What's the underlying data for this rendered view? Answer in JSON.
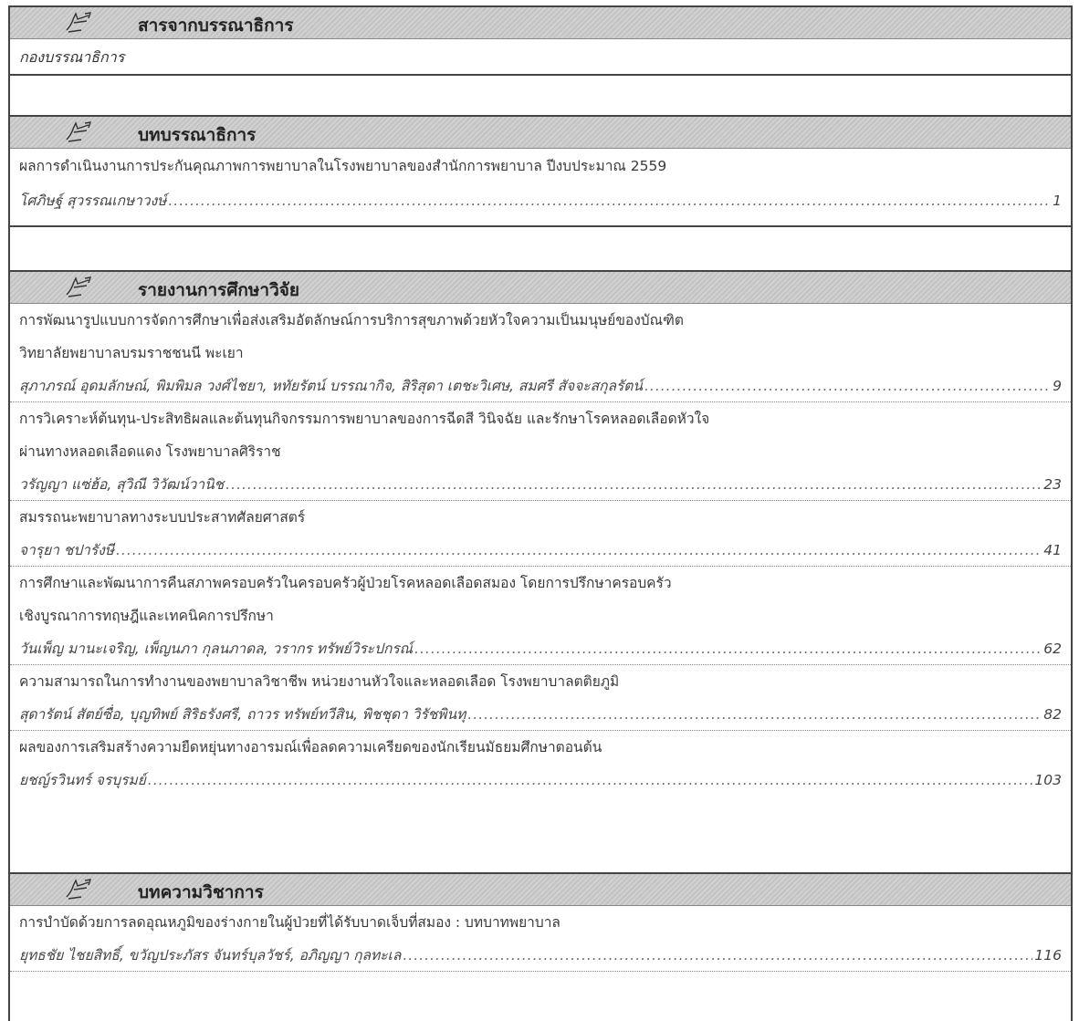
{
  "sections": [
    {
      "title": "สารจากบรรณาธิการ",
      "text": "กองบรรณาธิการ"
    },
    {
      "title": "บทบรรณาธิการ",
      "articles": [
        {
          "title_lines": [
            "ผลการดำเนินงานการประกันคุณภาพการพยาบาลในโรงพยาบาลของสำนักการพยาบาล ปีงบประมาณ 2559"
          ],
          "authors": "โศภิษฐ์ สุวรรณเกษาวงษ์",
          "page": "1"
        }
      ]
    },
    {
      "title": "รายงานการศึกษาวิจัย",
      "articles": [
        {
          "title_lines": [
            "การพัฒนารูปแบบการจัดการศึกษาเพื่อส่งเสริมอัตลักษณ์การบริการสุขภาพด้วยหัวใจความเป็นมนุษย์ของบัณฑิต",
            "วิทยาลัยพยาบาลบรมราชชนนี พะเยา"
          ],
          "authors": "สุภาภรณ์ อุดมลักษณ์, พิมพิมล วงศ์ไชยา, หทัยรัตน์ บรรณากิจ, สิริสุดา เตชะวิเศษ, สมศรี สัจจะสกุลรัตน์",
          "page": "9"
        },
        {
          "title_lines": [
            "การวิเคราะห์ต้นทุน-ประสิทธิผลและต้นทุนกิจกรรมการพยาบาลของการฉีดสี วินิจฉัย และรักษาโรคหลอดเลือดหัวใจ",
            "ผ่านทางหลอดเลือดแดง โรงพยาบาลศิริราช"
          ],
          "authors": "วรัญญา แซ่ฮ้อ, สุวิณี วิวัฒน์วานิช",
          "page": "23"
        },
        {
          "title_lines": [
            "สมรรถนะพยาบาลทางระบบประสาทศัลยศาสตร์"
          ],
          "authors": "จารุยา ชปารังษี",
          "page": "41"
        },
        {
          "title_lines": [
            "การศึกษาและพัฒนาการคืนสภาพครอบครัวในครอบครัวผู้ป่วยโรคหลอดเลือดสมอง โดยการปรึกษาครอบครัว",
            "เชิงบูรณาการทฤษฎีและเทคนิคการปรึกษา"
          ],
          "authors": "วันเพ็ญ มานะเจริญ, เพ็ญนภา กุลนภาดล, วรากร ทรัพย์วิระปกรณ์",
          "page": "62"
        },
        {
          "title_lines": [
            "ความสามารถในการทำงานของพยาบาลวิชาชีพ หน่วยงานหัวใจและหลอดเลือด โรงพยาบาลตติยภูมิ"
          ],
          "authors": "สุดารัตน์ สัตย์ซื่อ, บุญทิพย์ สิริธรังศรี, ถาวร ทรัพย์ทวีสิน, พิชชุดา วิรัชพินทุ",
          "page": "82"
        },
        {
          "title_lines": [
            "ผลของการเสริมสร้างความยืดหยุ่นทางอารมณ์เพื่อลดความเครียดของนักเรียนมัธยมศึกษาตอนต้น"
          ],
          "authors": "ยชญ์รวินทร์ จรบุรมย์",
          "page": "103"
        }
      ]
    },
    {
      "title": "บทความวิชาการ",
      "articles": [
        {
          "title_lines": [
            "การบำบัดด้วยการลดอุณหภูมิของร่างกายในผู้ป่วยที่ได้รับบาดเจ็บที่สมอง : บทบาทพยาบาล"
          ],
          "authors": "ยุทธชัย ไชยสิทธิ์, ขวัญประภัสร จันทร์บุลวัชร์, อภิญญา กุลทะเล",
          "page": "116"
        }
      ]
    }
  ],
  "icon": "pointing-hand-icon"
}
